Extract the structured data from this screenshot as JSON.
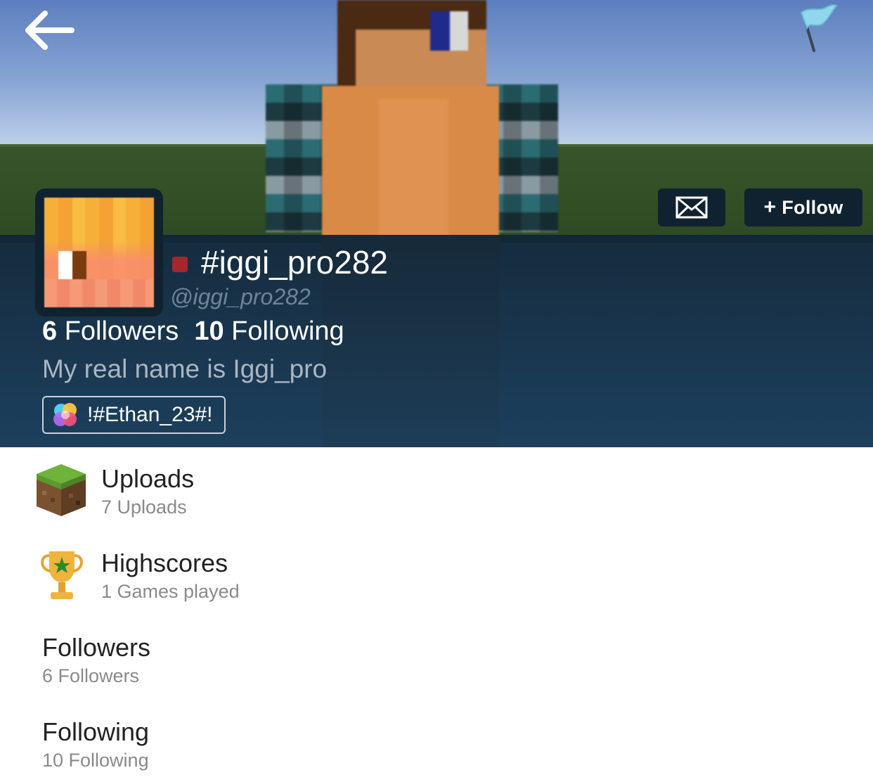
{
  "profile": {
    "display_name": "#iggi_pro282",
    "username": "@iggi_pro282",
    "followers_count": "6",
    "followers_label": "Followers",
    "following_count": "10",
    "following_label": "Following",
    "bio": "My real name is Iggi_pro",
    "clan_name": "!#Ethan_23#!",
    "status_color": "#a3282b"
  },
  "actions": {
    "follow_label": "Follow",
    "follow_plus": "+"
  },
  "icons": {
    "back": "arrow-left-icon",
    "flag": "flag-icon",
    "mail": "envelope-icon",
    "uploads": "grass-block-icon",
    "highscores": "trophy-icon",
    "clan": "clan-logo-icon"
  },
  "sections": [
    {
      "title": "Uploads",
      "subtitle": "7 Uploads"
    },
    {
      "title": "Highscores",
      "subtitle": "1 Games played"
    },
    {
      "title": "Followers",
      "subtitle": "6 Followers"
    },
    {
      "title": "Following",
      "subtitle": "10 Following"
    }
  ],
  "colors": {
    "panel": "#10222f",
    "overlay": "#163a58",
    "accent_flag": "#7fd0e8"
  }
}
